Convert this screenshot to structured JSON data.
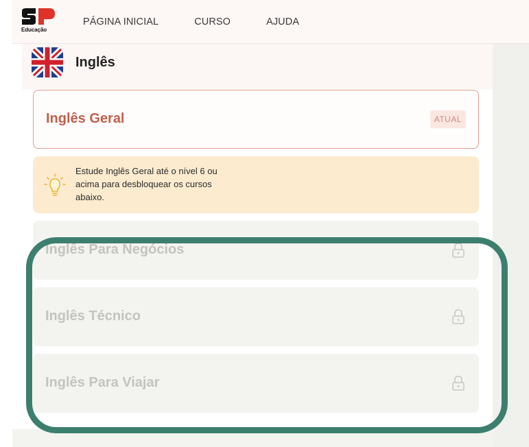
{
  "header": {
    "logo_text": "Educação",
    "nav": [
      "PÁGINA INICIAL",
      "CURSO",
      "AJUDA"
    ]
  },
  "course": {
    "title": "Inglês",
    "flag": "uk-flag-icon"
  },
  "current_course": {
    "title": "Inglês Geral",
    "badge": "ATUAL"
  },
  "tip": {
    "icon": "lightbulb-icon",
    "lines": [
      "Estude Inglês Geral até o nível 6 ou",
      "acima para desbloquear os cursos",
      "abaixo."
    ]
  },
  "locked_courses": [
    {
      "title": "Inglês Para Negócios",
      "icon": "lock-icon"
    },
    {
      "title": "Inglês Técnico",
      "icon": "lock-icon"
    },
    {
      "title": "Inglês Para Viajar",
      "icon": "lock-icon"
    }
  ],
  "colors": {
    "accent": "#c0604b",
    "highlight": "#3d7f6e",
    "tip_bg": "#fcebcf",
    "locked_bg": "#f3f3f0"
  }
}
